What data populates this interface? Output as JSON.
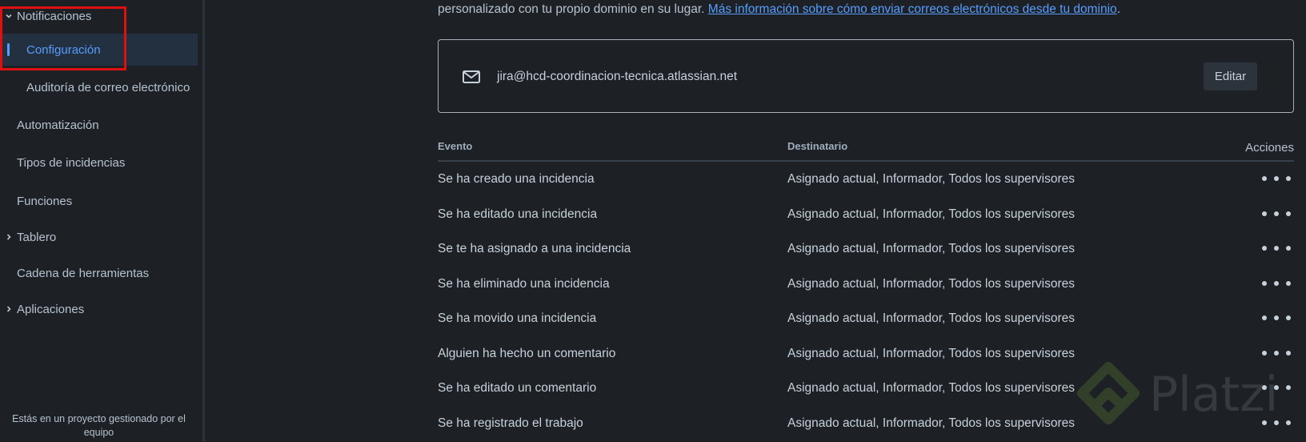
{
  "sidebar": {
    "items": [
      {
        "label": "Notificaciones",
        "chevron": "down"
      },
      {
        "label": "Configuración",
        "active": true
      },
      {
        "label": "Auditoría de correo electrónico"
      },
      {
        "label": "Automatización"
      },
      {
        "label": "Tipos de incidencias"
      },
      {
        "label": "Funciones"
      },
      {
        "label": "Tablero",
        "chevron": "right"
      },
      {
        "label": "Cadena de herramientas"
      },
      {
        "label": "Aplicaciones",
        "chevron": "right"
      }
    ],
    "footer": "Estás en un proyecto gestionado por el equipo"
  },
  "main": {
    "intro_text": "personalizado con tu propio dominio en su lugar.",
    "intro_link": "Más información sobre cómo enviar correos electrónicos desde tu dominio",
    "intro_end": ".",
    "email": {
      "icon": "mail-icon",
      "address": "jira@hcd-coordinacion-tecnica.atlassian.net",
      "edit_label": "Editar"
    },
    "table": {
      "headers": {
        "event": "Evento",
        "recipient": "Destinatario",
        "actions": "Acciones"
      },
      "rows": [
        {
          "event": "Se ha creado una incidencia",
          "recipient": "Asignado actual, Informador, Todos los supervisores"
        },
        {
          "event": "Se ha editado una incidencia",
          "recipient": "Asignado actual, Informador, Todos los supervisores"
        },
        {
          "event": "Se te ha asignado a una incidencia",
          "recipient": "Asignado actual, Informador, Todos los supervisores"
        },
        {
          "event": "Se ha eliminado una incidencia",
          "recipient": "Asignado actual, Informador, Todos los supervisores"
        },
        {
          "event": "Se ha movido una incidencia",
          "recipient": "Asignado actual, Informador, Todos los supervisores"
        },
        {
          "event": "Alguien ha hecho un comentario",
          "recipient": "Asignado actual, Informador, Todos los supervisores"
        },
        {
          "event": "Se ha editado un comentario",
          "recipient": "Asignado actual, Informador, Todos los supervisores"
        },
        {
          "event": "Se ha registrado el trabajo",
          "recipient": "Asignado actual, Informador, Todos los supervisores"
        }
      ]
    }
  },
  "watermark": {
    "text": "Platzi"
  },
  "colors": {
    "accent": "#579dff",
    "highlight": "#e01010",
    "background": "#1d2125"
  }
}
